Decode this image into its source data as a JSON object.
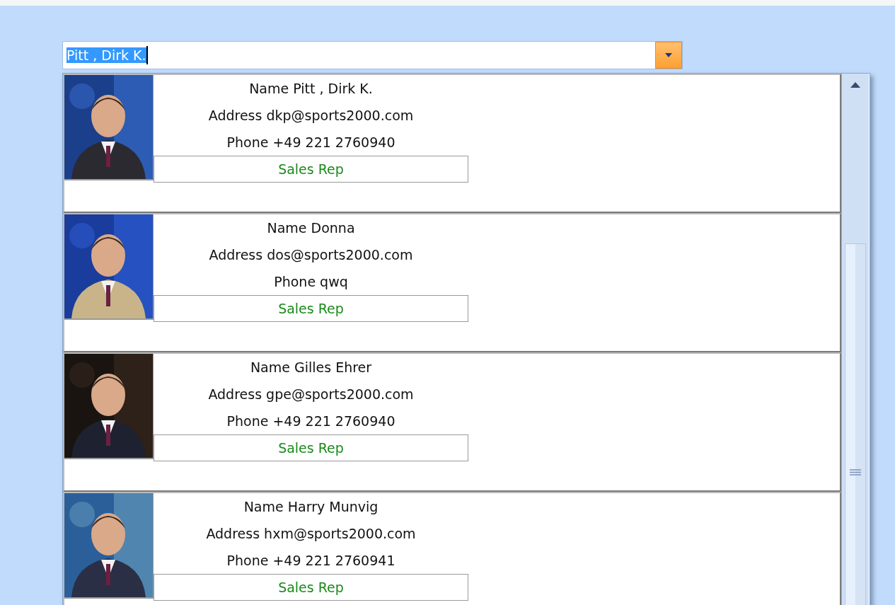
{
  "combo": {
    "value": "Pitt , Dirk K.",
    "text_selected": true
  },
  "list": {
    "items": [
      {
        "name": "Name Pitt , Dirk K.",
        "address": "Address dkp@sports2000.com",
        "phone": "Phone +49 221 2760940",
        "role": "Sales Rep"
      },
      {
        "name": "Name Donna",
        "address": "Address dos@sports2000.com",
        "phone": "Phone qwq",
        "role": "Sales Rep"
      },
      {
        "name": "Name Gilles Ehrer",
        "address": "Address gpe@sports2000.com",
        "phone": "Phone +49 221 2760940",
        "role": "Sales Rep"
      },
      {
        "name": "Name Harry Munvig",
        "address": "Address hxm@sports2000.com",
        "phone": "Phone +49 221 2760941",
        "role": "Sales Rep"
      }
    ]
  }
}
